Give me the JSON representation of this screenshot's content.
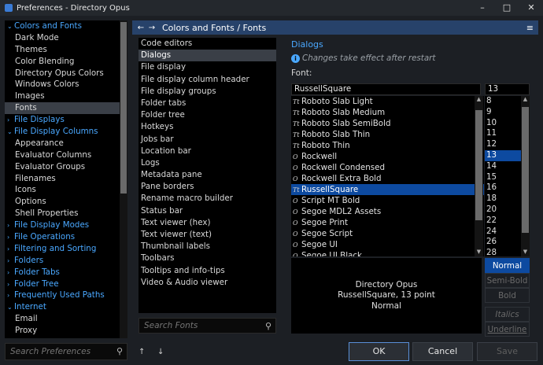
{
  "window": {
    "title": "Preferences - Directory Opus",
    "minimize_glyph": "–",
    "maximize_glyph": "□",
    "close_glyph": "✕"
  },
  "sidebar": {
    "items": [
      {
        "label": "Colors and Fonts",
        "type": "category",
        "expanded": true
      },
      {
        "label": "Dark Mode",
        "type": "child"
      },
      {
        "label": "Themes",
        "type": "child"
      },
      {
        "label": "Color Blending",
        "type": "child"
      },
      {
        "label": "Directory Opus Colors",
        "type": "child"
      },
      {
        "label": "Windows Colors",
        "type": "child"
      },
      {
        "label": "Images",
        "type": "child"
      },
      {
        "label": "Fonts",
        "type": "child",
        "selected": true
      },
      {
        "label": "File Displays",
        "type": "category",
        "expanded": false
      },
      {
        "label": "File Display Columns",
        "type": "category",
        "expanded": true
      },
      {
        "label": "Appearance",
        "type": "child"
      },
      {
        "label": "Evaluator Columns",
        "type": "child"
      },
      {
        "label": "Evaluator Groups",
        "type": "child"
      },
      {
        "label": "Filenames",
        "type": "child"
      },
      {
        "label": "Icons",
        "type": "child"
      },
      {
        "label": "Options",
        "type": "child"
      },
      {
        "label": "Shell Properties",
        "type": "child"
      },
      {
        "label": "File Display Modes",
        "type": "category",
        "expanded": false
      },
      {
        "label": "File Operations",
        "type": "category",
        "expanded": false
      },
      {
        "label": "Filtering and Sorting",
        "type": "category",
        "expanded": false
      },
      {
        "label": "Folders",
        "type": "category",
        "expanded": false
      },
      {
        "label": "Folder Tabs",
        "type": "category",
        "expanded": false
      },
      {
        "label": "Folder Tree",
        "type": "category",
        "expanded": false
      },
      {
        "label": "Frequently Used Paths",
        "type": "category",
        "expanded": false
      },
      {
        "label": "Internet",
        "type": "category",
        "expanded": true
      },
      {
        "label": "Email",
        "type": "child"
      },
      {
        "label": "Proxy",
        "type": "child"
      }
    ],
    "search_placeholder": "Search Preferences"
  },
  "header": {
    "back_glyph": "←",
    "forward_glyph": "→",
    "title": "Colors and Fonts / Fonts",
    "menu_glyph": "≡"
  },
  "pages": {
    "items": [
      "Code editors",
      "Dialogs",
      "File display",
      "File display column header",
      "File display groups",
      "Folder tabs",
      "Folder tree",
      "Hotkeys",
      "Jobs bar",
      "Location bar",
      "Logs",
      "Metadata pane",
      "Pane borders",
      "Rename macro builder",
      "Status bar",
      "Text viewer (hex)",
      "Text viewer (text)",
      "Thumbnail labels",
      "Toolbars",
      "Tooltips and info-tips",
      "Video & Audio viewer"
    ],
    "selected": "Dialogs",
    "search_placeholder": "Search Fonts"
  },
  "font_settings": {
    "section_title": "Dialogs",
    "note": "Changes take effect after restart",
    "font_label": "Font:",
    "font_name": "RussellSquare",
    "font_size": "13",
    "fonts": [
      {
        "name": "Roboto Slab Light",
        "icon": "Tt"
      },
      {
        "name": "Roboto Slab Medium",
        "icon": "Tt"
      },
      {
        "name": "Roboto Slab SemiBold",
        "icon": "Tt"
      },
      {
        "name": "Roboto Slab Thin",
        "icon": "Tt"
      },
      {
        "name": "Roboto Thin",
        "icon": "Tt"
      },
      {
        "name": "Rockwell",
        "icon": "O"
      },
      {
        "name": "Rockwell Condensed",
        "icon": "O"
      },
      {
        "name": "Rockwell Extra Bold",
        "icon": "O"
      },
      {
        "name": "RussellSquare",
        "icon": "Tt",
        "selected": true
      },
      {
        "name": "Script MT Bold",
        "icon": "O"
      },
      {
        "name": "Segoe MDL2 Assets",
        "icon": "O"
      },
      {
        "name": "Segoe Print",
        "icon": "O"
      },
      {
        "name": "Segoe Script",
        "icon": "O"
      },
      {
        "name": "Segoe UI",
        "icon": "O"
      },
      {
        "name": "Segoe UI Black",
        "icon": "O"
      }
    ],
    "sizes": [
      "8",
      "9",
      "10",
      "11",
      "12",
      "13",
      "14",
      "15",
      "16",
      "18",
      "20",
      "22",
      "24",
      "26",
      "28"
    ],
    "selected_size": "13",
    "preview": {
      "line1": "Directory Opus",
      "line2": "RussellSquare, 13 point",
      "line3": "Normal"
    },
    "styles": {
      "normal": "Normal",
      "semibold": "Semi-Bold",
      "bold": "Bold",
      "italics": "Italics",
      "underline": "Underline"
    }
  },
  "footer": {
    "move_up_glyph": "↑",
    "move_down_glyph": "↓",
    "ok": "OK",
    "cancel": "Cancel",
    "save": "Save"
  },
  "colors": {
    "accent": "#4aa8ff",
    "selection": "#0d4aa0",
    "header_bg": "#27426a"
  }
}
